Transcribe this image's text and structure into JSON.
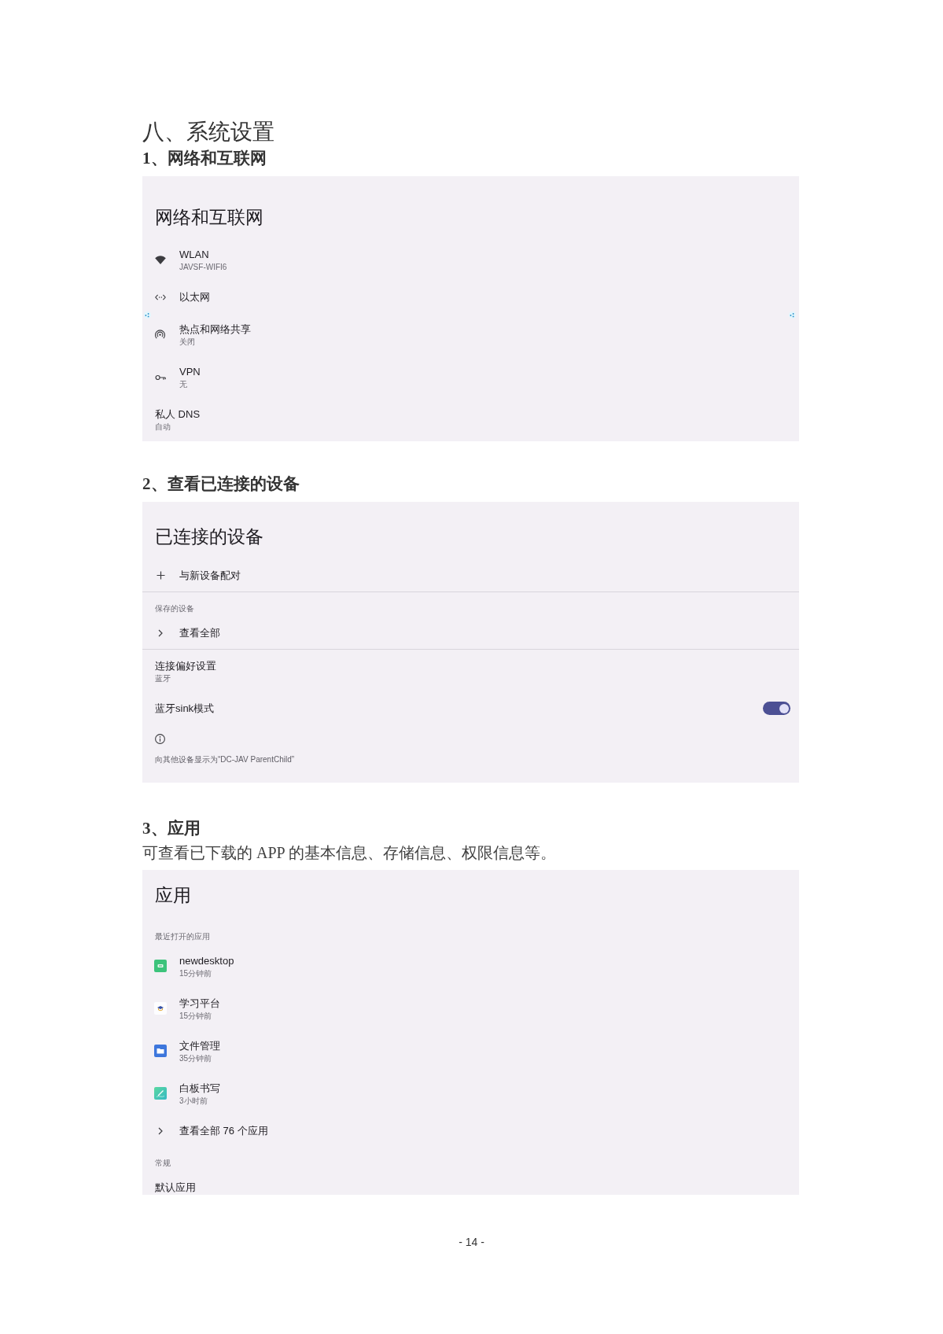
{
  "document": {
    "chapter": "八、系统设置",
    "page_number": "- 14 -"
  },
  "sections": [
    {
      "heading": "1、网络和互联网",
      "screen": {
        "title": "网络和互联网",
        "items": [
          {
            "kind": "wifi",
            "title": "WLAN",
            "summary": "JAVSF-WIFI6"
          },
          {
            "kind": "ethernet",
            "title": "以太网"
          },
          {
            "kind": "hotspot",
            "title": "热点和网络共享",
            "summary": "关闭"
          },
          {
            "kind": "vpn",
            "title": "VPN",
            "summary": "无"
          },
          {
            "kind": "plain",
            "title": "私人 DNS",
            "summary": "自动"
          }
        ]
      }
    },
    {
      "heading": "2、查看已连接的设备",
      "screen": {
        "title": "已连接的设备",
        "items": [
          {
            "kind": "add",
            "title": "与新设备配对"
          },
          {
            "kind": "divider"
          },
          {
            "kind": "header",
            "title": "保存的设备"
          },
          {
            "kind": "more",
            "title": "查看全部"
          },
          {
            "kind": "divider"
          },
          {
            "kind": "plain",
            "title": "连接偏好设置",
            "summary": "蓝牙"
          },
          {
            "kind": "toggle",
            "title": "蓝牙sink模式",
            "on": true
          },
          {
            "kind": "info"
          },
          {
            "kind": "note",
            "title": "向其他设备显示为“DC-JAV ParentChild”"
          }
        ]
      }
    },
    {
      "heading": "3、应用",
      "description": "可查看已下载的 APP 的基本信息、存储信息、权限信息等。",
      "screen": {
        "title": "应用",
        "items": [
          {
            "kind": "header",
            "title": "最近打开的应用"
          },
          {
            "kind": "app",
            "title": "newdesktop",
            "summary": "15分钟前"
          },
          {
            "kind": "app",
            "title": "学习平台",
            "summary": "15分钟前"
          },
          {
            "kind": "app",
            "title": "文件管理",
            "summary": "35分钟前"
          },
          {
            "kind": "app",
            "title": "白板书写",
            "summary": "3小时前"
          },
          {
            "kind": "more",
            "title": "查看全部 76 个应用"
          },
          {
            "kind": "header",
            "title": "常规"
          },
          {
            "kind": "plain",
            "title": "默认应用"
          }
        ]
      }
    }
  ]
}
